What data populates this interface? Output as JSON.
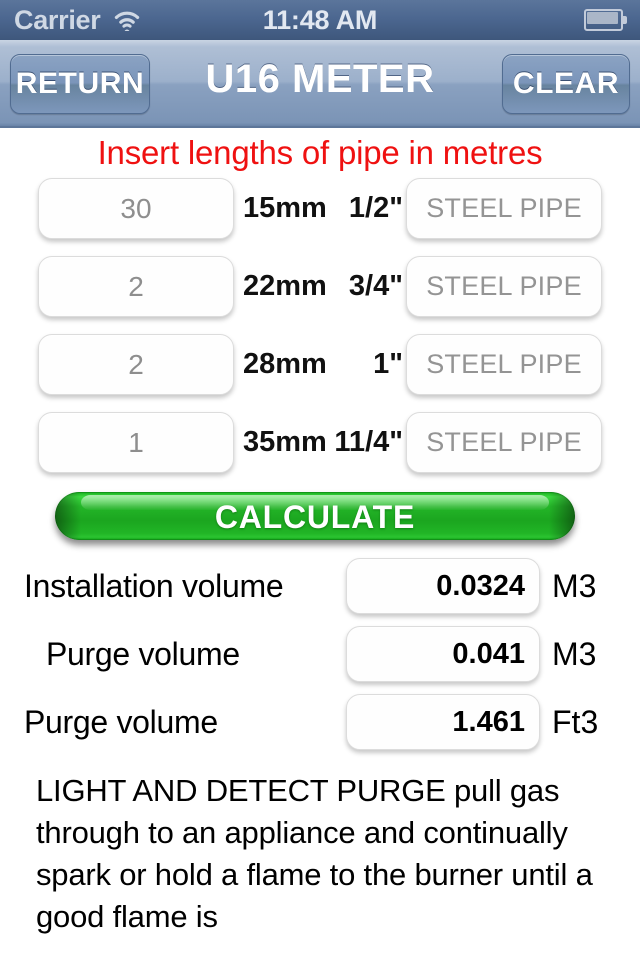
{
  "status_bar": {
    "carrier": "Carrier",
    "wifi_icon": "wifi-icon",
    "time": "11:48 AM",
    "battery_icon": "battery-icon"
  },
  "nav_bar": {
    "back_label": "RETURN",
    "title": "U16  METER",
    "clear_label": "CLEAR"
  },
  "main": {
    "headline": "Insert lengths of pipe in metres",
    "pipe_rows": [
      {
        "length": "30",
        "size_mm": "15mm",
        "size_in": "1/2\"",
        "material": "STEEL PIPE"
      },
      {
        "length": "2",
        "size_mm": "22mm",
        "size_in": "3/4\"",
        "material": "STEEL PIPE"
      },
      {
        "length": "2",
        "size_mm": "28mm",
        "size_in": "1\"",
        "material": "STEEL PIPE"
      },
      {
        "length": "1",
        "size_mm": "35mm",
        "size_in": "11/4\"",
        "material": "STEEL PIPE"
      }
    ],
    "calculate_label": "CALCULATE",
    "results": [
      {
        "label": "Installation volume",
        "value": "0.0324",
        "unit": "M3"
      },
      {
        "label": "Purge volume",
        "value": "0.041",
        "unit": "M3"
      },
      {
        "label": "Purge volume",
        "value": "1.461",
        "unit": "Ft3"
      }
    ],
    "note": "LIGHT AND DETECT PURGE pull gas through to an appliance and continually spark or hold a flame to the burner until a good flame is"
  },
  "colors": {
    "headline_red": "#ef1111",
    "calculate_green": "#24b528",
    "nav_blue": "#8aa1c0",
    "status_blue": "#4c6790"
  }
}
